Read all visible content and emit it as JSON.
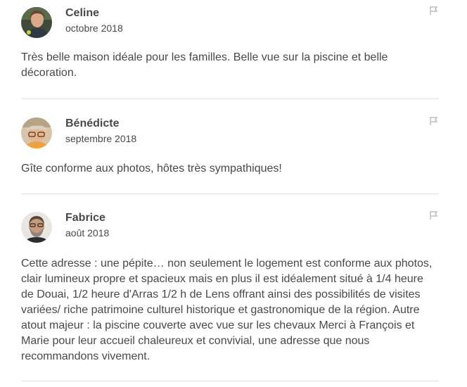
{
  "reviews": [
    {
      "name": "Celine",
      "date": "octobre 2018",
      "text": "Très belle maison idéale pour les familles. Belle vue sur la piscine et belle décoration."
    },
    {
      "name": "Bénédicte",
      "date": "septembre 2018",
      "text": "Gîte conforme aux photos, hôtes très sympathiques!"
    },
    {
      "name": "Fabrice",
      "date": "août 2018",
      "text": "Cette adresse : une pépite… non seulement le logement est conforme aux photos, clair lumineux propre et spacieux mais en plus il est idéalement situé à 1/4 heure de Douai, 1/2 heure d'Arras 1/2 h de Lens offrant ainsi des possibilités de visites variées/ riche patrimoine culturel historique et gastronomique de la région. Autre atout majeur : la piscine couverte avec vue sur les chevaux Merci à François et Marie pour leur accueil chaleureux et convivial, une adresse que nous recommandons vivement."
    }
  ],
  "icons": {
    "report": "flag-icon"
  },
  "colors": {
    "text": "#484848",
    "divider": "#e4e4e4",
    "flag": "#b0b0b0"
  }
}
